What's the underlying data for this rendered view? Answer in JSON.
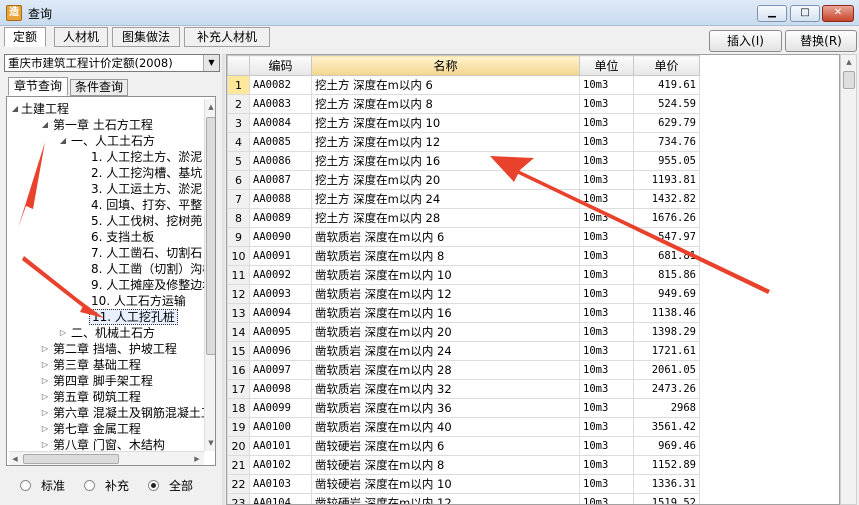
{
  "window": {
    "title": "查询",
    "app_icon": "app-icon",
    "min_glyph": "▁",
    "max_glyph": "□",
    "close_glyph": "✕"
  },
  "tabs": [
    {
      "label": "定额"
    },
    {
      "label": "人材机"
    },
    {
      "label": "图集做法"
    },
    {
      "label": "补充人材机"
    }
  ],
  "toolbar": {
    "insert_label": "插入(I)",
    "replace_label": "替换(R)"
  },
  "quota_library": {
    "selected": "重庆市建筑工程计价定额(2008)"
  },
  "subtabs": [
    {
      "label": "章节查询"
    },
    {
      "label": "条件查询"
    }
  ],
  "tree": [
    {
      "label": "土建工程",
      "twisty": "◢"
    },
    {
      "label": "第一章 土石方工程",
      "twisty": "◢"
    },
    {
      "label": "一、人工土石方",
      "twisty": "◢"
    },
    {
      "label": "1. 人工挖土方、淤泥"
    },
    {
      "label": "2. 人工挖沟槽、基坑"
    },
    {
      "label": "3. 人工运土方、淤泥"
    },
    {
      "label": "4. 回填、打夯、平整"
    },
    {
      "label": "5. 人工伐树、挖树蔸"
    },
    {
      "label": "6. 支挡土板"
    },
    {
      "label": "7. 人工凿石、切割石"
    },
    {
      "label": "8. 人工凿（切割）沟槽"
    },
    {
      "label": "9. 人工摊座及修整边坡"
    },
    {
      "label": "10. 人工石方运输"
    },
    {
      "label": "11. 人工挖孔桩"
    },
    {
      "label": "二、机械土石方",
      "twisty": "▷"
    },
    {
      "label": "第二章 挡墙、护坡工程",
      "twisty": "▷"
    },
    {
      "label": "第三章 基础工程",
      "twisty": "▷"
    },
    {
      "label": "第四章 脚手架工程",
      "twisty": "▷"
    },
    {
      "label": "第五章 砌筑工程",
      "twisty": "▷"
    },
    {
      "label": "第六章 混凝土及钢筋混凝土工程",
      "twisty": "▷"
    },
    {
      "label": "第七章 金属工程",
      "twisty": "▷"
    },
    {
      "label": "第八章 门窗、木结构",
      "twisty": "▷"
    }
  ],
  "filter": {
    "options": [
      {
        "label": "标准"
      },
      {
        "label": "补充"
      },
      {
        "label": "全部"
      }
    ],
    "selected": "全部"
  },
  "grid": {
    "columns": [
      "",
      "编码",
      "名称",
      "单位",
      "单价"
    ],
    "rows": [
      {
        "n": "1",
        "code": "AA0082",
        "name": "挖土方 深度在m以内 6",
        "unit": "10m3",
        "price": "419.61"
      },
      {
        "n": "2",
        "code": "AA0083",
        "name": "挖土方 深度在m以内 8",
        "unit": "10m3",
        "price": "524.59"
      },
      {
        "n": "3",
        "code": "AA0084",
        "name": "挖土方 深度在m以内 10",
        "unit": "10m3",
        "price": "629.79"
      },
      {
        "n": "4",
        "code": "AA0085",
        "name": "挖土方 深度在m以内 12",
        "unit": "10m3",
        "price": "734.76"
      },
      {
        "n": "5",
        "code": "AA0086",
        "name": "挖土方 深度在m以内 16",
        "unit": "10m3",
        "price": "955.05"
      },
      {
        "n": "6",
        "code": "AA0087",
        "name": "挖土方 深度在m以内 20",
        "unit": "10m3",
        "price": "1193.81"
      },
      {
        "n": "7",
        "code": "AA0088",
        "name": "挖土方 深度在m以内 24",
        "unit": "10m3",
        "price": "1432.82"
      },
      {
        "n": "8",
        "code": "AA0089",
        "name": "挖土方 深度在m以内 28",
        "unit": "10m3",
        "price": "1676.26"
      },
      {
        "n": "9",
        "code": "AA0090",
        "name": "凿软质岩 深度在m以内 6",
        "unit": "10m3",
        "price": "547.97"
      },
      {
        "n": "10",
        "code": "AA0091",
        "name": "凿软质岩 深度在m以内 8",
        "unit": "10m3",
        "price": "681.81"
      },
      {
        "n": "11",
        "code": "AA0092",
        "name": "凿软质岩 深度在m以内 10",
        "unit": "10m3",
        "price": "815.86"
      },
      {
        "n": "12",
        "code": "AA0093",
        "name": "凿软质岩 深度在m以内 12",
        "unit": "10m3",
        "price": "949.69"
      },
      {
        "n": "13",
        "code": "AA0094",
        "name": "凿软质岩 深度在m以内 16",
        "unit": "10m3",
        "price": "1138.46"
      },
      {
        "n": "14",
        "code": "AA0095",
        "name": "凿软质岩 深度在m以内 20",
        "unit": "10m3",
        "price": "1398.29"
      },
      {
        "n": "15",
        "code": "AA0096",
        "name": "凿软质岩 深度在m以内 24",
        "unit": "10m3",
        "price": "1721.61"
      },
      {
        "n": "16",
        "code": "AA0097",
        "name": "凿软质岩 深度在m以内 28",
        "unit": "10m3",
        "price": "2061.05"
      },
      {
        "n": "17",
        "code": "AA0098",
        "name": "凿软质岩 深度在m以内 32",
        "unit": "10m3",
        "price": "2473.26"
      },
      {
        "n": "18",
        "code": "AA0099",
        "name": "凿软质岩 深度在m以内 36",
        "unit": "10m3",
        "price": "2968"
      },
      {
        "n": "19",
        "code": "AA0100",
        "name": "凿软质岩 深度在m以内 40",
        "unit": "10m3",
        "price": "3561.42"
      },
      {
        "n": "20",
        "code": "AA0101",
        "name": "凿较硬岩 深度在m以内 6",
        "unit": "10m3",
        "price": "969.46"
      },
      {
        "n": "21",
        "code": "AA0102",
        "name": "凿较硬岩 深度在m以内 8",
        "unit": "10m3",
        "price": "1152.89"
      },
      {
        "n": "22",
        "code": "AA0103",
        "name": "凿较硬岩 深度在m以内 10",
        "unit": "10m3",
        "price": "1336.31"
      },
      {
        "n": "23",
        "code": "AA0104",
        "name": "凿较硬岩 深度在m以内 12",
        "unit": "10m3",
        "price": "1519.52"
      }
    ]
  },
  "annotation": {
    "arrow_color": "#e8412c"
  }
}
